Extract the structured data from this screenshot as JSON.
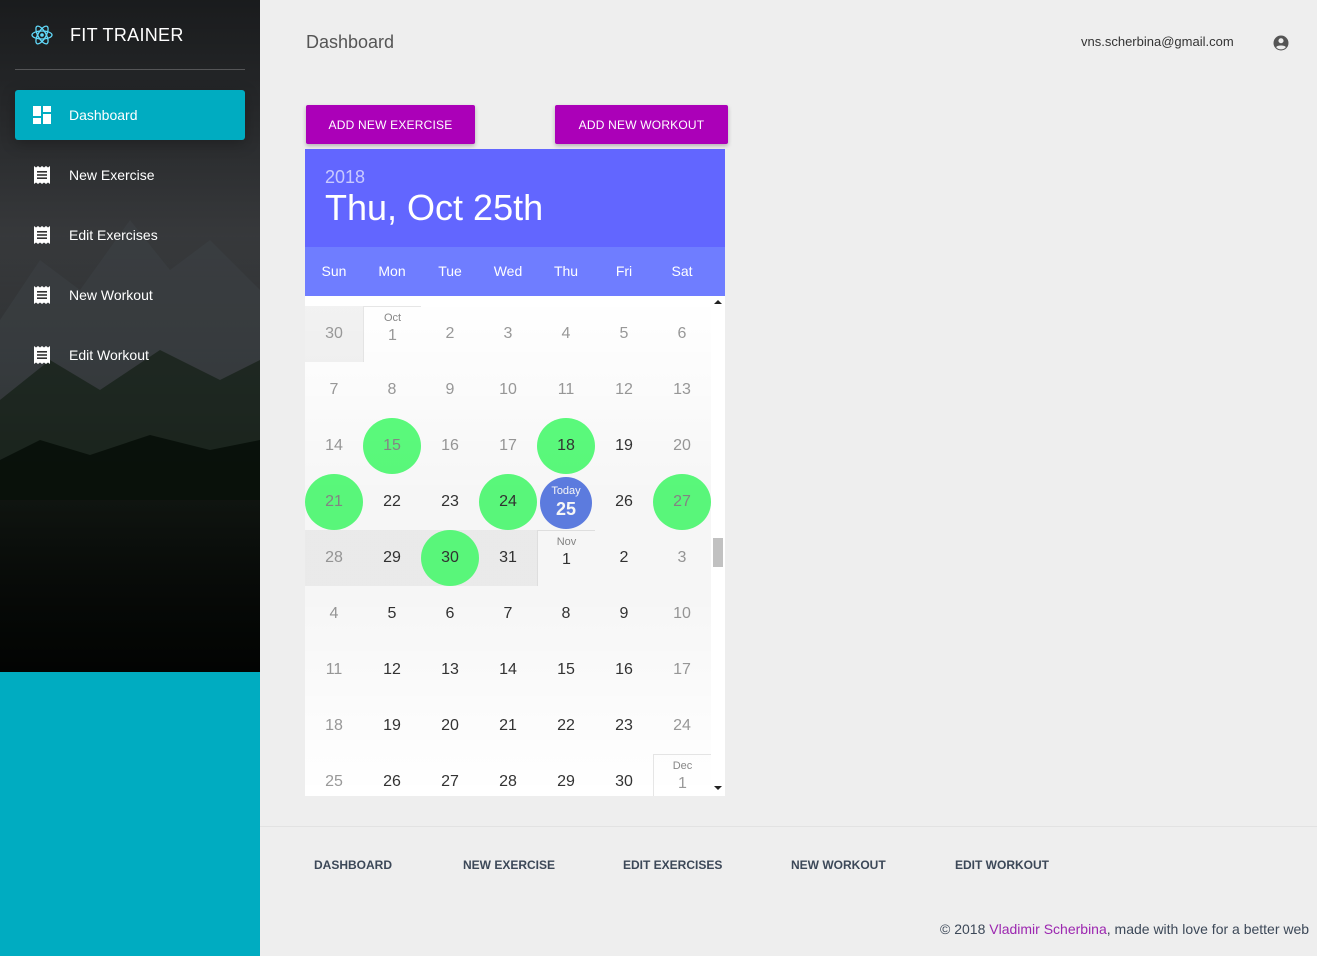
{
  "brand": {
    "title": "FIT TRAINER",
    "logo_icon": "react-atom-icon",
    "accent": "#00acc1"
  },
  "sidebar": {
    "items": [
      {
        "label": "Dashboard",
        "icon": "dashboard-icon",
        "active": true
      },
      {
        "label": "New Exercise",
        "icon": "receipt-icon",
        "active": false
      },
      {
        "label": "Edit Exercises",
        "icon": "receipt-icon",
        "active": false
      },
      {
        "label": "New Workout",
        "icon": "receipt-icon",
        "active": false
      },
      {
        "label": "Edit Workout",
        "icon": "receipt-icon",
        "active": false
      }
    ]
  },
  "header": {
    "title": "Dashboard",
    "email": "vns.scherbina@gmail.com",
    "user_icon": "account-circle-icon"
  },
  "actions": {
    "add_exercise": "ADD NEW EXERCISE",
    "add_workout": "ADD NEW WORKOUT",
    "color": "#ab00b8"
  },
  "calendar": {
    "year": "2018",
    "selected_date": "Thu, Oct 25th",
    "weekdays": [
      "Sun",
      "Mon",
      "Tue",
      "Wed",
      "Thu",
      "Fri",
      "Sat"
    ],
    "today_label": "Today",
    "workout_color": "#5cff7e",
    "today_color": "#5f7fe6",
    "weeks": [
      [
        {
          "d": "30",
          "prev": true,
          "grey": true
        },
        {
          "d": "1",
          "month": "Oct",
          "start": true
        },
        {
          "d": "2"
        },
        {
          "d": "3"
        },
        {
          "d": "4"
        },
        {
          "d": "5"
        },
        {
          "d": "6"
        }
      ],
      [
        {
          "d": "7"
        },
        {
          "d": "8"
        },
        {
          "d": "9"
        },
        {
          "d": "10"
        },
        {
          "d": "11"
        },
        {
          "d": "12"
        },
        {
          "d": "13"
        }
      ],
      [
        {
          "d": "14"
        },
        {
          "d": "15",
          "workout": true
        },
        {
          "d": "16"
        },
        {
          "d": "17"
        },
        {
          "d": "18",
          "workout": true,
          "dark": true
        },
        {
          "d": "19",
          "dark": true
        },
        {
          "d": "20"
        }
      ],
      [
        {
          "d": "21",
          "workout": true
        },
        {
          "d": "22",
          "dark": true
        },
        {
          "d": "23",
          "dark": true
        },
        {
          "d": "24",
          "workout": true,
          "dark": true
        },
        {
          "d": "25",
          "today": true
        },
        {
          "d": "26",
          "dark": true
        },
        {
          "d": "27",
          "workout": true
        }
      ],
      [
        {
          "d": "28",
          "grey": true
        },
        {
          "d": "29",
          "dark": true,
          "grey": true
        },
        {
          "d": "30",
          "workout": true,
          "dark": true,
          "grey": true
        },
        {
          "d": "31",
          "dark": true,
          "grey": true
        },
        {
          "d": "1",
          "month": "Nov",
          "start": true,
          "dark": true
        },
        {
          "d": "2",
          "selected": true,
          "dark": true
        },
        {
          "d": "3"
        }
      ],
      [
        {
          "d": "4"
        },
        {
          "d": "5",
          "dark": true
        },
        {
          "d": "6",
          "dark": true
        },
        {
          "d": "7",
          "dark": true
        },
        {
          "d": "8",
          "dark": true
        },
        {
          "d": "9",
          "dark": true
        },
        {
          "d": "10"
        }
      ],
      [
        {
          "d": "11"
        },
        {
          "d": "12",
          "dark": true
        },
        {
          "d": "13",
          "dark": true
        },
        {
          "d": "14",
          "dark": true
        },
        {
          "d": "15",
          "dark": true
        },
        {
          "d": "16",
          "dark": true
        },
        {
          "d": "17"
        }
      ],
      [
        {
          "d": "18"
        },
        {
          "d": "19",
          "dark": true
        },
        {
          "d": "20",
          "dark": true
        },
        {
          "d": "21",
          "dark": true
        },
        {
          "d": "22",
          "dark": true
        },
        {
          "d": "23",
          "dark": true
        },
        {
          "d": "24"
        }
      ],
      [
        {
          "d": "25"
        },
        {
          "d": "26",
          "dark": true
        },
        {
          "d": "27",
          "dark": true
        },
        {
          "d": "28",
          "dark": true
        },
        {
          "d": "29",
          "dark": true
        },
        {
          "d": "30",
          "dark": true
        },
        {
          "d": "1",
          "month": "Dec",
          "start": true
        }
      ]
    ]
  },
  "footer": {
    "links": [
      "DASHBOARD",
      "NEW EXERCISE",
      "EDIT EXERCISES",
      "NEW WORKOUT",
      "EDIT WORKOUT"
    ],
    "copyright_prefix": "© 2018 ",
    "author": "Vladimir Scherbina",
    "copyright_suffix": ", made with love for a better web"
  }
}
